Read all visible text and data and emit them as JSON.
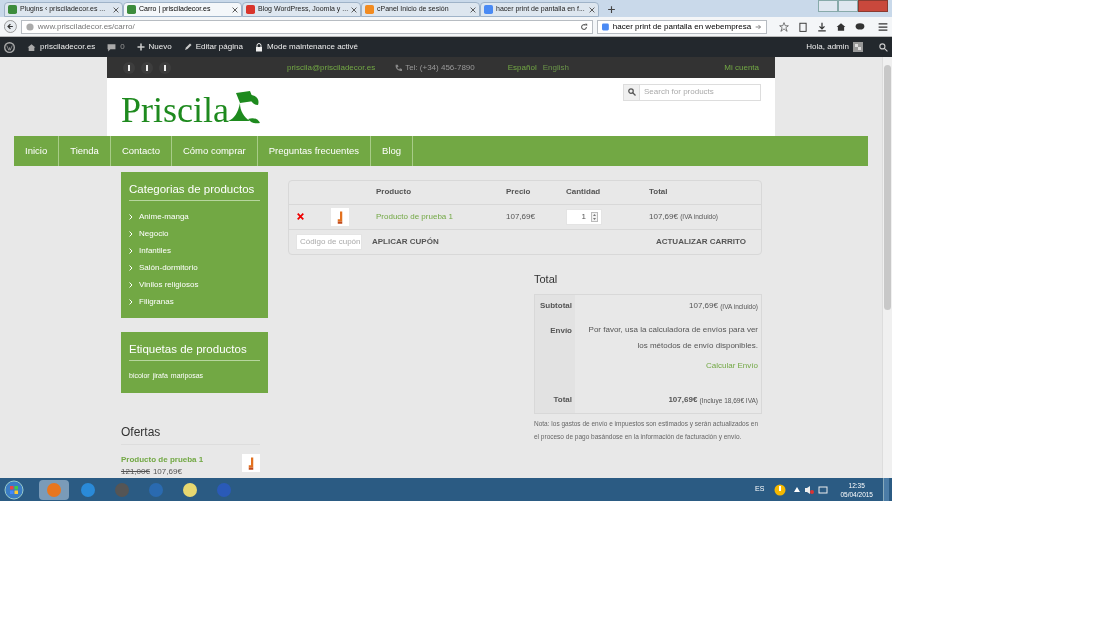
{
  "browser": {
    "tabs": [
      {
        "title": "Plugins ‹ prisciladecor.es ...",
        "selected": false
      },
      {
        "title": "Carro | prisciladecor.es",
        "selected": true
      },
      {
        "title": "Blog WordPress, Joomla y ...",
        "selected": false
      },
      {
        "title": "cPanel Inicio de sesión",
        "selected": false
      },
      {
        "title": "hacer print de pantalla en f...",
        "selected": false
      }
    ],
    "address": "www.prisciladecor.es/carro/",
    "search": "hacer print de pantalla en webempresa"
  },
  "admin_bar": {
    "site": "prisciladecor.es",
    "comments": "0",
    "new": "Nuevo",
    "edit": "Editar página",
    "maintenance": "Mode maintenance activé",
    "greeting": "Hola, admin"
  },
  "topbar": {
    "email": "priscila@prisciladecor.es",
    "phone": "Tel: (+34) 456-7890",
    "languages": [
      {
        "label": "Español",
        "selected": true
      },
      {
        "label": "English",
        "selected": false
      }
    ],
    "account": "Mi cuenta"
  },
  "header": {
    "logo": "Priscila",
    "search_placeholder": "Search for products"
  },
  "nav": [
    "Inicio",
    "Tienda",
    "Contacto",
    "Cómo comprar",
    "Preguntas frecuentes",
    "Blog"
  ],
  "sidebar": {
    "categories": {
      "title": "Categorias de productos",
      "items": [
        "Anime-manga",
        "Negocio",
        "Infantiles",
        "Salón-dormitorio",
        "Vinilos religiosos",
        "Filigranas"
      ]
    },
    "tags": {
      "title": "Etiquetas de productos",
      "items": [
        "bicolor",
        "jirafa",
        "mariposas"
      ]
    },
    "offers": {
      "title": "Ofertas",
      "items": [
        {
          "name": "Producto de prueba 1",
          "old_price": "121,00€",
          "price": "107,69€"
        }
      ]
    }
  },
  "cart": {
    "columns": [
      "Producto",
      "Precio",
      "Cantidad",
      "Total"
    ],
    "rows": [
      {
        "product": "Producto de prueba 1",
        "price": "107,69€",
        "quantity": "1",
        "total": "107,69€",
        "tax_note": "(IVA incluido)"
      }
    ],
    "coupon_placeholder": "Código de cupón",
    "apply": "APLICAR CUPÓN",
    "update": "ACTUALIZAR CARRITO"
  },
  "totals": {
    "title": "Total",
    "subtotal_label": "Subtotal",
    "subtotal": "107,69€",
    "subtotal_note": "(IVA incluido)",
    "shipping_label": "Envío",
    "shipping_text": "Por favor, usa la calculadora de envíos para ver los métodos de envío disponibles.",
    "shipping_link": "Calcular Envío",
    "total_label": "Total",
    "total": "107,69€",
    "total_note": "(Incluye 18,69€ IVA)",
    "note": "Nota: los gastos de envío e impuestos son estimados y serán actualizados en el proceso de pago basándose en la información de facturación y envío."
  },
  "taskbar": {
    "language": "ES",
    "time": "12:35",
    "date": "05/04/2015"
  }
}
